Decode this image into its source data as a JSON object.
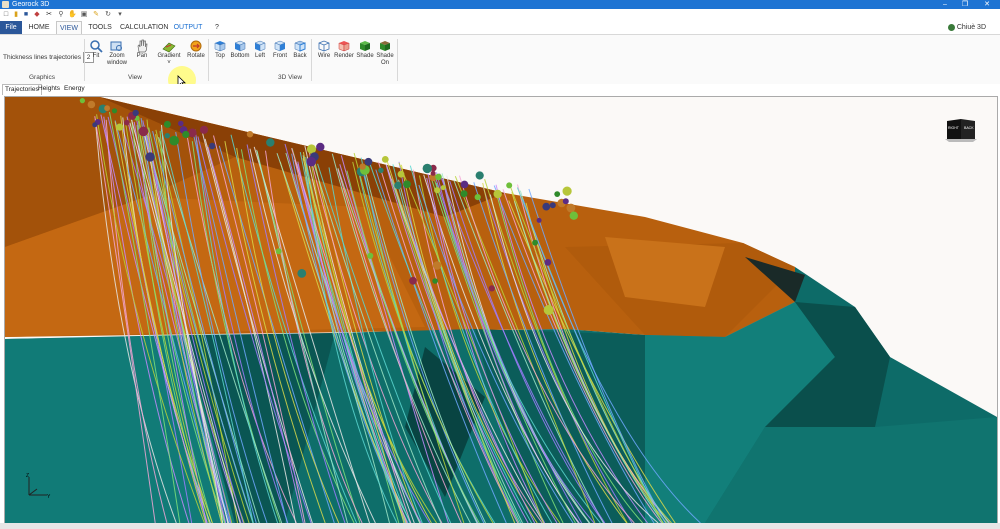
{
  "window": {
    "title": "Georock 3D"
  },
  "tabs": [
    {
      "label": "File"
    },
    {
      "label": "HOME"
    },
    {
      "label": "VIEW"
    },
    {
      "label": "TOOLS"
    },
    {
      "label": "CALCULATION"
    },
    {
      "label": "OUTPUT"
    },
    {
      "label": "?"
    }
  ],
  "user": {
    "name": "Chiuè 3D"
  },
  "ribbon": {
    "graphics": {
      "label": "Graphics",
      "thickness_label": "Thickness lines trajectories",
      "thickness_value": "2"
    },
    "view": {
      "label": "View",
      "fit": "Fit",
      "zoom_window_1": "Zoom",
      "zoom_window_2": "window",
      "pan": "Pan",
      "gradient": "Gradient",
      "gradient_arrow": "˅",
      "rotate": "Rotate"
    },
    "view3d": {
      "label": "3D View",
      "top": "Top",
      "bottom": "Bottom",
      "left": "Left",
      "front": "Front",
      "back": "Back",
      "wire": "Wire",
      "render": "Render",
      "shade": "Shade",
      "shade_on_1": "Shade",
      "shade_on_2": "On"
    }
  },
  "subtabs": [
    {
      "label": "Trajectories"
    },
    {
      "label": "Heights"
    },
    {
      "label": "Energy"
    }
  ],
  "viewport": {
    "cube_left": "RIGHT",
    "cube_right": "BACK",
    "colors": {
      "slope": "#b8600e",
      "cliff": "#0d6b68",
      "ground": "#fbf9f7"
    }
  }
}
